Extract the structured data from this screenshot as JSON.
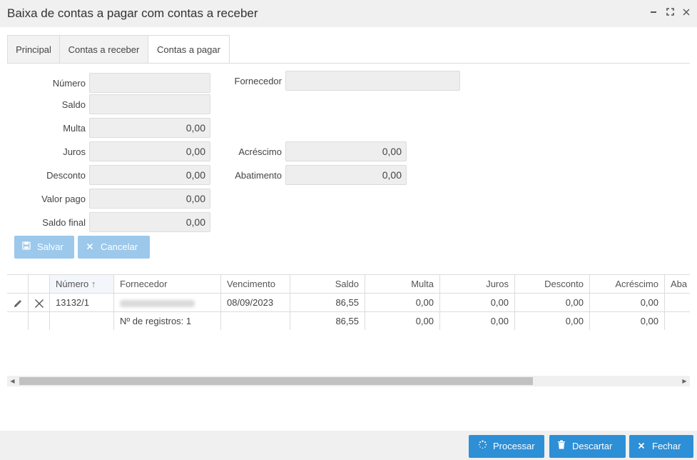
{
  "window": {
    "title": "Baixa de contas a pagar com contas a receber",
    "minimize_icon": "minimize-icon",
    "maximize_icon": "maximize-icon",
    "close_icon": "close-icon"
  },
  "tabs": [
    {
      "label": "Principal",
      "active": false
    },
    {
      "label": "Contas a receber",
      "active": false
    },
    {
      "label": "Contas a pagar",
      "active": true
    }
  ],
  "form": {
    "numero": {
      "label": "Número",
      "value": ""
    },
    "saldo": {
      "label": "Saldo",
      "value": ""
    },
    "multa": {
      "label": "Multa",
      "value": "0,00"
    },
    "juros": {
      "label": "Juros",
      "value": "0,00"
    },
    "desconto": {
      "label": "Desconto",
      "value": "0,00"
    },
    "valor_pago": {
      "label": "Valor pago",
      "value": "0,00"
    },
    "saldo_final": {
      "label": "Saldo final",
      "value": "0,00"
    },
    "fornecedor": {
      "label": "Fornecedor",
      "value": ""
    },
    "acrescimo": {
      "label": "Acréscimo",
      "value": "0,00"
    },
    "abatimento": {
      "label": "Abatimento",
      "value": "0,00"
    }
  },
  "form_buttons": {
    "save": {
      "label": "Salvar",
      "icon": "floppy-disk-icon"
    },
    "cancel": {
      "label": "Cancelar",
      "icon": "x-icon"
    }
  },
  "grid": {
    "columns": [
      "Número",
      "Fornecedor",
      "Vencimento",
      "Saldo",
      "Multa",
      "Juros",
      "Desconto",
      "Acréscimo",
      "Aba"
    ],
    "sort_indicator": "↑",
    "rows": [
      {
        "numero": "13132/1",
        "fornecedor": "",
        "vencimento": "08/09/2023",
        "saldo": "86,55",
        "multa": "0,00",
        "juros": "0,00",
        "desconto": "0,00",
        "acrescimo": "0,00"
      }
    ],
    "summary": {
      "label": "Nº de registros: 1",
      "saldo": "86,55",
      "multa": "0,00",
      "juros": "0,00",
      "desconto": "0,00",
      "acrescimo": "0,00"
    }
  },
  "footer_buttons": {
    "process": {
      "label": "Processar",
      "icon": "spinner-icon"
    },
    "discard": {
      "label": "Descartar",
      "icon": "trash-icon"
    },
    "close": {
      "label": "Fechar",
      "icon": "x-icon"
    }
  },
  "colors": {
    "primary": "#2d8fd6",
    "primary_disabled": "#9cc8eb",
    "field_bg": "#eeeeee"
  }
}
